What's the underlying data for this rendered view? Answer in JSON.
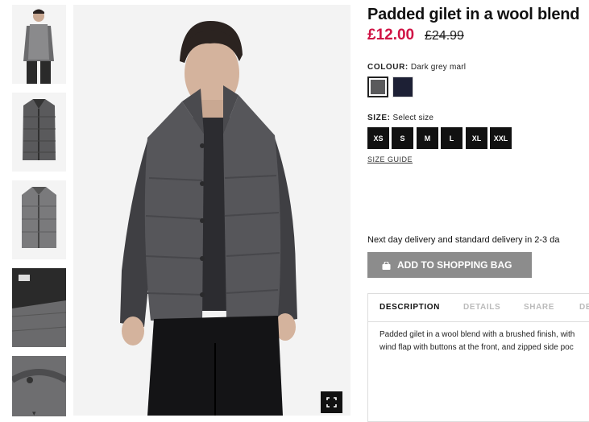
{
  "product": {
    "title": "Padded gilet in a wool blend",
    "price": "£12.00",
    "old_price": "£24.99"
  },
  "colour": {
    "label": "COLOUR:",
    "selected": "Dark grey marl",
    "swatches": [
      {
        "name": "Dark grey marl",
        "color": "#5a5a5c"
      },
      {
        "name": "Navy",
        "color": "#1d2035"
      }
    ]
  },
  "size": {
    "label": "SIZE:",
    "prompt": "Select size",
    "options": [
      "XS",
      "S",
      "M",
      "L",
      "XL",
      "XXL"
    ],
    "guide": "SIZE GUIDE"
  },
  "delivery": "Next day delivery and standard delivery in 2-3 da",
  "add_to_bag": "ADD TO SHOPPING BAG",
  "tabs": [
    "DESCRIPTION",
    "DETAILS",
    "SHARE",
    "DE"
  ],
  "description_lines": [
    "Padded gilet in a wool blend with a brushed finish, with",
    "wind flap with buttons at the front, and zipped side poc"
  ],
  "colors": {
    "sale_red": "#d01345",
    "button_grey": "#8c8c8c",
    "size_black": "#111111"
  },
  "icons": {
    "fullscreen": "expand-icon",
    "bag": "shopping-bag-icon",
    "more": "chevron-down-icon"
  }
}
